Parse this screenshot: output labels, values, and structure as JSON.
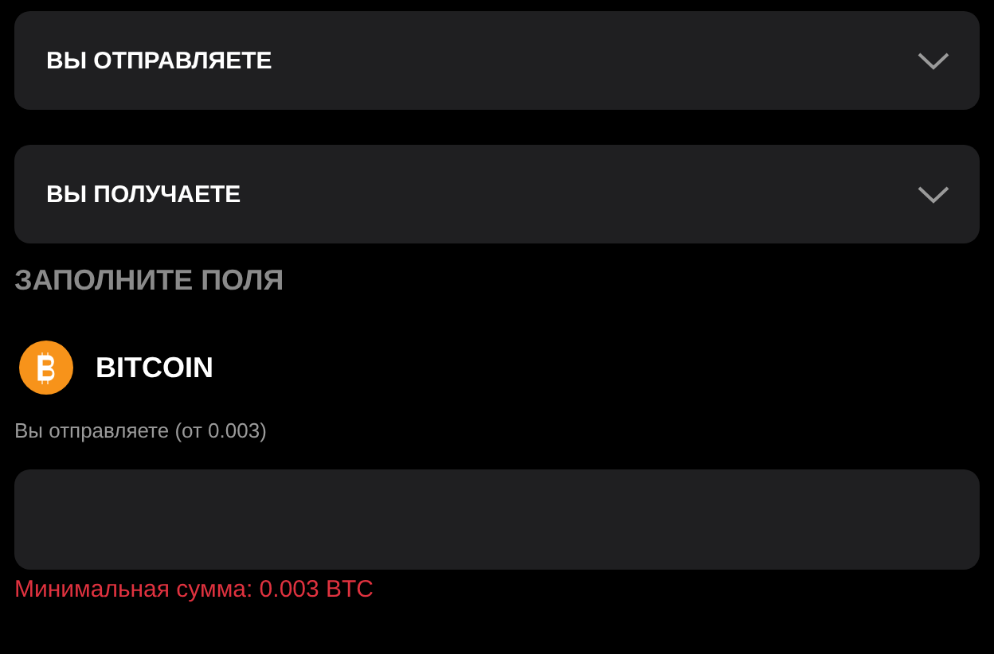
{
  "dropdowns": [
    {
      "label": "ВЫ ОТПРАВЛЯЕТЕ"
    },
    {
      "label": "ВЫ ПОЛУЧАЕТЕ"
    }
  ],
  "form": {
    "heading": "ЗАПОЛНИТЕ ПОЛЯ",
    "currency": "BITCOIN",
    "field_label": "Вы отправляете (от 0.003)",
    "error": "Минимальная сумма: 0.003 BTC"
  }
}
